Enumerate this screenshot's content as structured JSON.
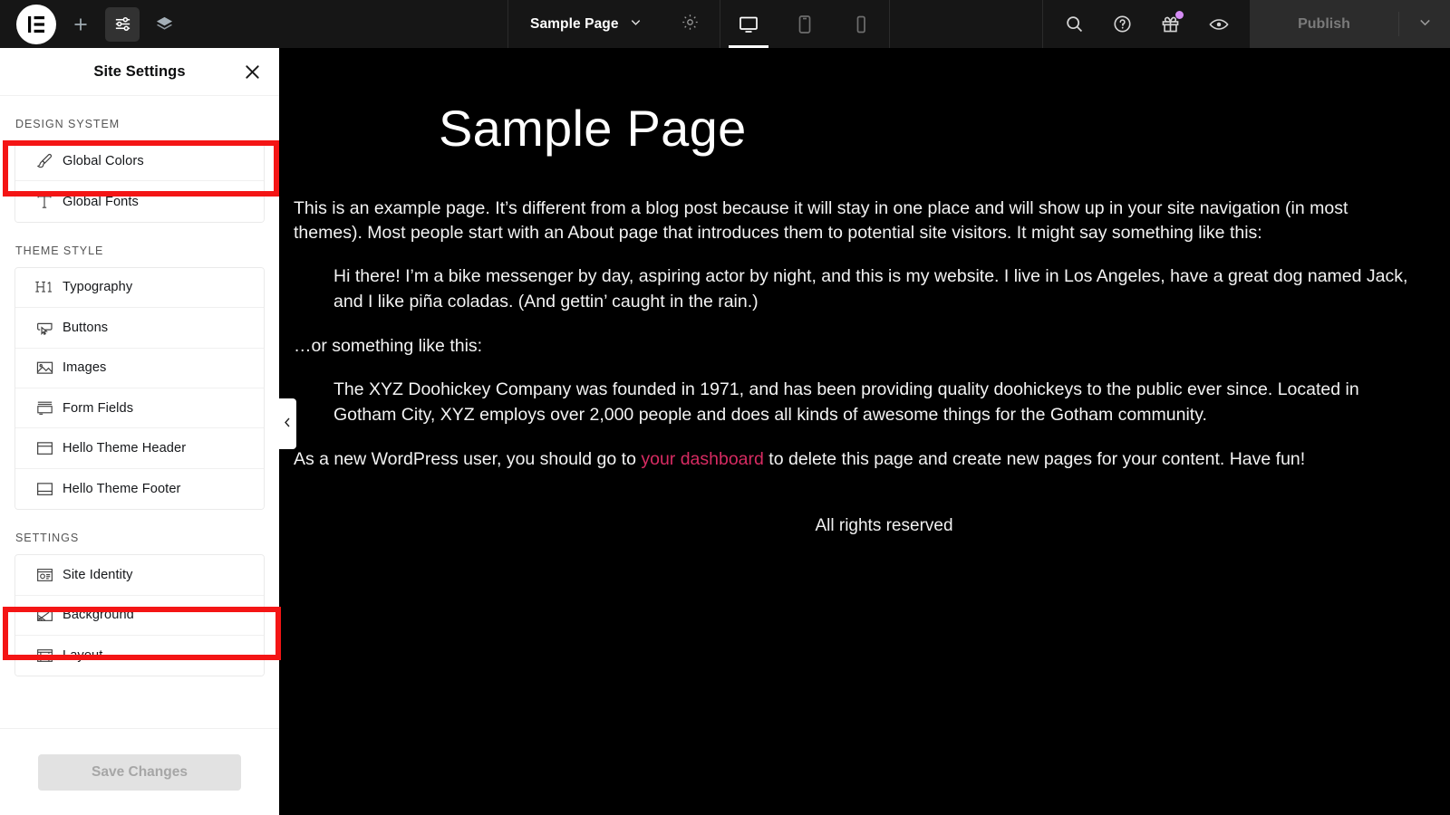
{
  "topbar": {
    "logo_icon": "elementor-logo-icon",
    "add_icon": "plus-icon",
    "settings_icon": "sliders-icon",
    "layers_icon": "layers-icon",
    "page_title": "Sample Page",
    "page_chevron_icon": "chevron-down-icon",
    "page_settings_icon": "gear-icon",
    "devices": [
      {
        "name": "desktop",
        "icon": "monitor-icon",
        "active": true
      },
      {
        "name": "tablet",
        "icon": "tablet-icon",
        "active": false
      },
      {
        "name": "mobile",
        "icon": "mobile-icon",
        "active": false
      }
    ],
    "search_icon": "search-icon",
    "help_icon": "question-circle-icon",
    "gift_icon": "gift-icon",
    "gift_badge_color": "#d58cf5",
    "preview_icon": "eye-icon",
    "publish_label": "Publish",
    "publish_caret_icon": "chevron-down-icon"
  },
  "panel": {
    "title": "Site Settings",
    "close_icon": "close-icon",
    "collapse_icon": "chevron-left-icon",
    "sections": [
      {
        "label": "DESIGN SYSTEM",
        "items": [
          {
            "label": "Global Colors",
            "icon": "paintbrush-icon",
            "highlighted": true
          },
          {
            "label": "Global Fonts",
            "icon": "text-t-icon",
            "highlighted": false
          }
        ]
      },
      {
        "label": "THEME STYLE",
        "items": [
          {
            "label": "Typography",
            "icon": "h1-heading-icon",
            "highlighted": false
          },
          {
            "label": "Buttons",
            "icon": "button-cursor-icon",
            "highlighted": false
          },
          {
            "label": "Images",
            "icon": "image-icon",
            "highlighted": false
          },
          {
            "label": "Form Fields",
            "icon": "form-fields-icon",
            "highlighted": false
          },
          {
            "label": "Hello Theme Header",
            "icon": "header-layout-icon",
            "highlighted": false
          },
          {
            "label": "Hello Theme Footer",
            "icon": "footer-layout-icon",
            "highlighted": false
          }
        ]
      },
      {
        "label": "SETTINGS",
        "items": [
          {
            "label": "Site Identity",
            "icon": "id-card-icon",
            "highlighted": false
          },
          {
            "label": "Background",
            "icon": "background-icon",
            "highlighted": true
          },
          {
            "label": "Layout",
            "icon": "layout-grid-icon",
            "highlighted": false
          }
        ]
      }
    ],
    "save_label": "Save Changes"
  },
  "annotations": {
    "highlight_color": "#f41515",
    "boxes": [
      {
        "target": "Global Colors"
      },
      {
        "target": "Background"
      }
    ]
  },
  "canvas": {
    "heading": "Sample Page",
    "paragraph_1": "This is an example page. It’s different from a blog post because it will stay in one place and will show up in your site navigation (in most themes). Most people start with an About page that introduces them to potential site visitors. It might say something like this:",
    "quote_1": "Hi there! I’m a bike messenger by day, aspiring actor by night, and this is my website. I live in Los Angeles, have a great dog named Jack, and I like piña coladas. (And gettin’ caught in the rain.)",
    "paragraph_2": "…or something like this:",
    "quote_2": "The XYZ Doohickey Company was founded in 1971, and has been providing quality doohickeys to the public ever since. Located in Gotham City, XYZ employs over 2,000 people and does all kinds of awesome things for the Gotham community.",
    "paragraph_3_before": "As a new WordPress user, you should go to ",
    "paragraph_3_link": "your dashboard",
    "paragraph_3_after": " to delete this page and create new pages for your content. Have fun!",
    "link_color": "#d72b62",
    "footer_text": "All rights reserved"
  }
}
